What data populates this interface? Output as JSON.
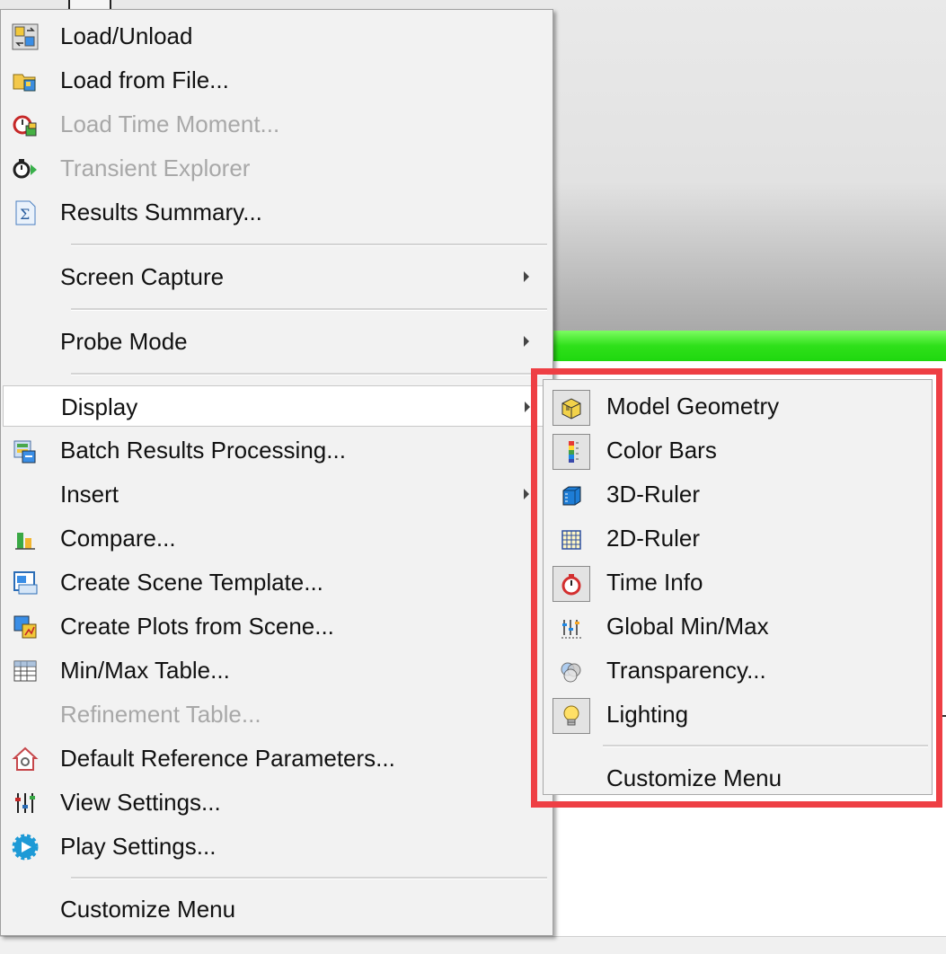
{
  "main_menu": {
    "items": [
      {
        "label": "Load/Unload",
        "icon": "load-unload-icon",
        "enabled": true
      },
      {
        "label": "Load from File...",
        "icon": "load-file-icon",
        "enabled": true
      },
      {
        "label": "Load Time Moment...",
        "icon": "time-moment-icon",
        "enabled": false
      },
      {
        "label": "Transient Explorer",
        "icon": "transient-explorer-icon",
        "enabled": false
      },
      {
        "label": "Results Summary...",
        "icon": "sigma-icon",
        "enabled": true
      },
      {
        "label": "Screen Capture",
        "has_submenu": true
      },
      {
        "label": "Probe Mode",
        "has_submenu": true
      },
      {
        "label": "Display",
        "has_submenu": true,
        "highlighted": true
      },
      {
        "label": "Batch Results Processing...",
        "icon": "batch-processing-icon",
        "enabled": true
      },
      {
        "label": "Insert",
        "has_submenu": true
      },
      {
        "label": "Compare...",
        "icon": "compare-icon",
        "enabled": true
      },
      {
        "label": "Create Scene Template...",
        "icon": "scene-template-icon",
        "enabled": true
      },
      {
        "label": "Create Plots from Scene...",
        "icon": "plots-from-scene-icon",
        "enabled": true
      },
      {
        "label": "Min/Max Table...",
        "icon": "table-icon",
        "enabled": true
      },
      {
        "label": "Refinement Table...",
        "enabled": false
      },
      {
        "label": "Default Reference Parameters...",
        "icon": "house-icon",
        "enabled": true
      },
      {
        "label": "View Settings...",
        "icon": "sliders-icon",
        "enabled": true
      },
      {
        "label": "Play Settings...",
        "icon": "play-gear-icon",
        "enabled": true
      },
      {
        "label": "Customize Menu"
      }
    ]
  },
  "display_submenu": {
    "items": [
      {
        "label": "Model Geometry",
        "icon": "model-geometry-icon",
        "checked": true
      },
      {
        "label": "Color Bars",
        "icon": "color-bars-icon",
        "checked": true
      },
      {
        "label": "3D-Ruler",
        "icon": "3d-ruler-icon",
        "checked": false
      },
      {
        "label": "2D-Ruler",
        "icon": "2d-ruler-icon",
        "checked": false
      },
      {
        "label": "Time Info",
        "icon": "stopwatch-icon",
        "checked": true
      },
      {
        "label": "Global Min/Max",
        "icon": "min-max-icon",
        "checked": false
      },
      {
        "label": "Transparency...",
        "icon": "transparency-icon",
        "checked": false
      },
      {
        "label": "Lighting",
        "icon": "lightbulb-icon",
        "checked": true
      },
      {
        "label": "Customize Menu"
      }
    ]
  },
  "colors": {
    "highlight_frame": "#ee3f44",
    "green_bar": "#2fe01a",
    "disabled_text": "#a8a8a8"
  }
}
